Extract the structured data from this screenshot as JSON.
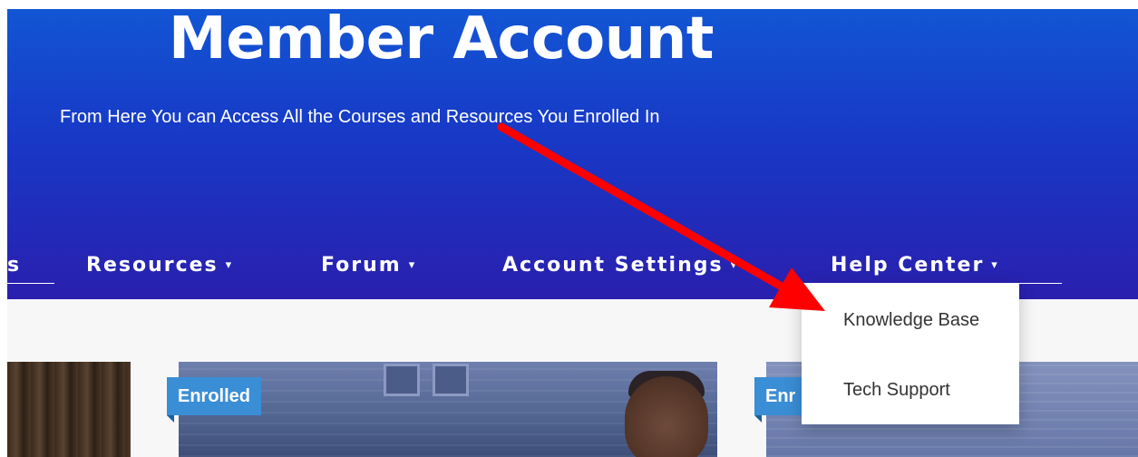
{
  "hero": {
    "title": "Member Account",
    "subtitle": "From Here You can Access All the Courses and Resources You Enrolled In"
  },
  "nav": {
    "items": [
      {
        "label": "s",
        "has_caret": false
      },
      {
        "label": "Resources",
        "has_caret": true
      },
      {
        "label": "Forum",
        "has_caret": true
      },
      {
        "label": "Account Settings",
        "has_caret": true
      },
      {
        "label": "Help Center",
        "has_caret": true
      }
    ],
    "caret_glyph": "▾"
  },
  "dropdown": {
    "parent": "Help Center",
    "items": [
      {
        "label": "Knowledge Base"
      },
      {
        "label": "Tech Support"
      }
    ]
  },
  "cards": [
    {
      "badge": ""
    },
    {
      "badge": "Enrolled"
    },
    {
      "badge": "Enr"
    }
  ],
  "colors": {
    "hero_top": "#1256d4",
    "hero_bottom": "#2a1fae",
    "badge": "#3a8ed6",
    "annotation_arrow": "#ff0000"
  },
  "annotation": {
    "type": "red-arrow",
    "points_to": "Knowledge Base"
  }
}
